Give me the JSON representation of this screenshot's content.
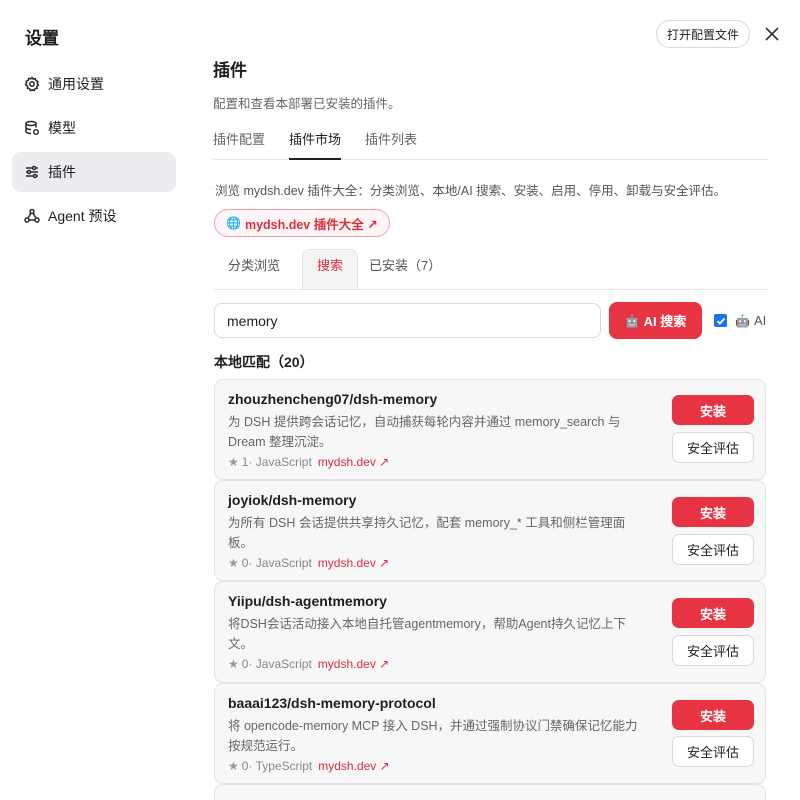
{
  "sidebar": {
    "title": "设置",
    "items": [
      {
        "label": "通用设置",
        "icon": "gear-icon"
      },
      {
        "label": "模型",
        "icon": "database-icon"
      },
      {
        "label": "插件",
        "icon": "sliders-icon"
      },
      {
        "label": "Agent 预设",
        "icon": "agent-icon"
      }
    ]
  },
  "header": {
    "open_config_label": "打开配置文件"
  },
  "main": {
    "title": "插件",
    "description": "配置和查看本部署已安装的插件。",
    "tabs": [
      {
        "label": "插件配置"
      },
      {
        "label": "插件市场"
      },
      {
        "label": "插件列表"
      }
    ],
    "active_tab": "插件市场"
  },
  "market": {
    "description": "浏览 mydsh.dev 插件大全：分类浏览、本地/AI 搜索、安装、启用、停用、卸载与安全评估。",
    "link_label": "mydsh.dev 插件大全 ↗",
    "subtabs": [
      {
        "label": "分类浏览"
      },
      {
        "label": "搜索"
      },
      {
        "label": "已安装（7）"
      }
    ],
    "active_subtab": "搜索"
  },
  "search": {
    "value": "memory",
    "ai_button_label": "AI 搜索",
    "ai_toggle_label": "AI",
    "ai_toggle_checked": true
  },
  "results": {
    "section_title": "本地匹配（20）",
    "items": [
      {
        "name": "zhouzhencheng07/dsh-memory",
        "description": "为 DSH 提供跨会话记忆，自动捕获每轮内容并通过 memory_search 与 Dream 整理沉淀。",
        "stars": "1",
        "language": "· JavaScript",
        "link": "mydsh.dev ↗",
        "install_label": "安装",
        "eval_label": "安全评估"
      },
      {
        "name": "joyiok/dsh-memory",
        "description": "为所有 DSH 会话提供共享持久记忆，配套 memory_* 工具和侧栏管理面板。",
        "stars": "0",
        "language": "· JavaScript",
        "link": "mydsh.dev ↗",
        "install_label": "安装",
        "eval_label": "安全评估"
      },
      {
        "name": "Yiipu/dsh-agentmemory",
        "description": "将DSH会话活动接入本地自托管agentmemory，帮助Agent持久记忆上下文。",
        "stars": "0",
        "language": "· JavaScript",
        "link": "mydsh.dev ↗",
        "install_label": "安装",
        "eval_label": "安全评估"
      },
      {
        "name": "baaai123/dsh-memory-protocol",
        "description": "将 opencode-memory MCP 接入 DSH，并通过强制协议门禁确保记忆能力按规范运行。",
        "stars": "0",
        "language": "· TypeScript",
        "link": "mydsh.dev ↗",
        "install_label": "安装",
        "eval_label": "安全评估"
      }
    ]
  },
  "colors": {
    "accent": "#e63443",
    "active_nav_bg": "#ebedf0",
    "checkbox": "#1a73e8"
  }
}
